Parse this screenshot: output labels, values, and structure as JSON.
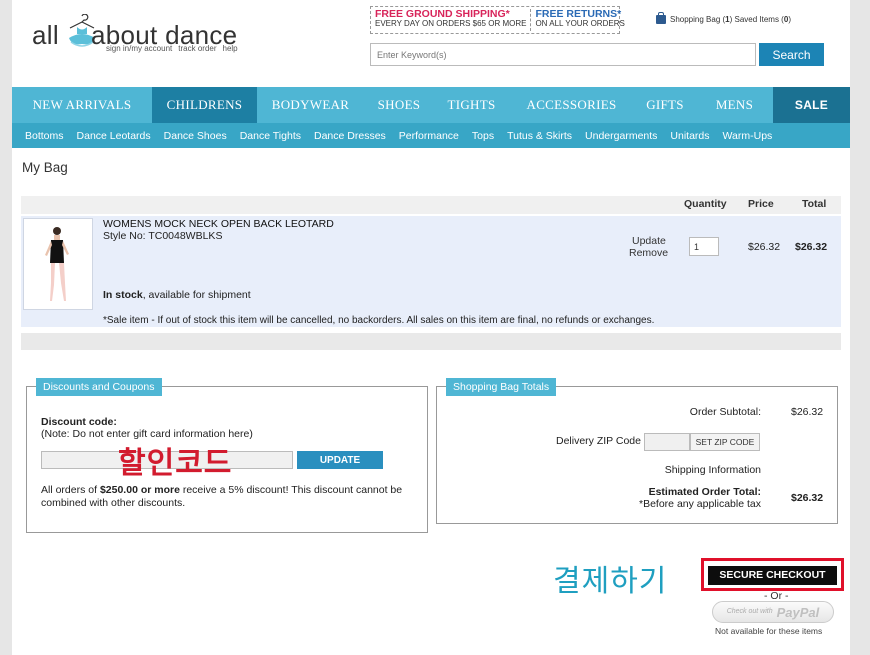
{
  "header": {
    "logo_all": "all",
    "logo_rest": "about dance",
    "logo_links": [
      "sign in/my account",
      "track order",
      "help"
    ],
    "promo": {
      "ship_big": "FREE GROUND SHIPPING*",
      "ship_small": "EVERY DAY ON ORDERS $65 OR MORE",
      "ret_big": "FREE RETURNS*",
      "ret_small": "ON ALL YOUR ORDERS"
    },
    "bag_label": "Shopping Bag (",
    "bag_count": "1",
    "bag_mid": ")  Saved Items (",
    "saved_count": "0",
    "bag_end": ")",
    "search_placeholder": "Enter Keyword(s)",
    "search_label": "Search"
  },
  "nav": {
    "items": [
      "NEW ARRIVALS",
      "CHILDRENS",
      "BODYWEAR",
      "SHOES",
      "TIGHTS",
      "ACCESSORIES",
      "GIFTS",
      "MENS",
      "SALE"
    ],
    "active": "CHILDRENS"
  },
  "subnav": [
    "Bottoms",
    "Dance Leotards",
    "Dance Shoes",
    "Dance Tights",
    "Dance Dresses",
    "Performance",
    "Tops",
    "Tutus & Skirts",
    "Undergarments",
    "Unitards",
    "Warm-Ups"
  ],
  "bag": {
    "title": "My Bag",
    "columns": {
      "quantity": "Quantity",
      "price": "Price",
      "total": "Total"
    },
    "item": {
      "name": "WOMENS MOCK NECK OPEN BACK LEOTARD",
      "style": "Style No: TC0048WBLKS",
      "stock_bold": "In stock",
      "stock_rest": ", available for shipment",
      "sale_note": "*Sale item - If out of stock this item will be cancelled, no backorders. All sales on this item are final, no refunds or exchanges.",
      "update": "Update",
      "remove": "Remove",
      "quantity": "1",
      "price": "$26.32",
      "total": "$26.32"
    }
  },
  "discounts": {
    "title": "Discounts and Coupons",
    "label": "Discount code:",
    "note": "(Note: Do not enter gift card information here)",
    "update_label": "UPDATE",
    "promo_pre": "All orders of ",
    "promo_amount": "$250.00 or more",
    "promo_post": " receive a 5% discount! This discount cannot be combined with other discounts.",
    "annotation": "할인코드"
  },
  "totals": {
    "title": "Shopping Bag Totals",
    "subtotal_label": "Order Subtotal:",
    "subtotal_value": "$26.32",
    "zip_label": "Delivery ZIP Code",
    "zip_button": "SET ZIP CODE",
    "shipping_info": "Shipping Information",
    "estimated_label": "Estimated Order Total:",
    "estimated_note": "*Before any applicable tax",
    "estimated_value": "$26.32"
  },
  "checkout": {
    "annotation": "결제하기",
    "button_label": "SECURE CHECKOUT",
    "or_text": "- Or -",
    "paypal_small": "Check out with",
    "paypal_logo": "PayPal",
    "paypal_note": "Not available for these items"
  }
}
